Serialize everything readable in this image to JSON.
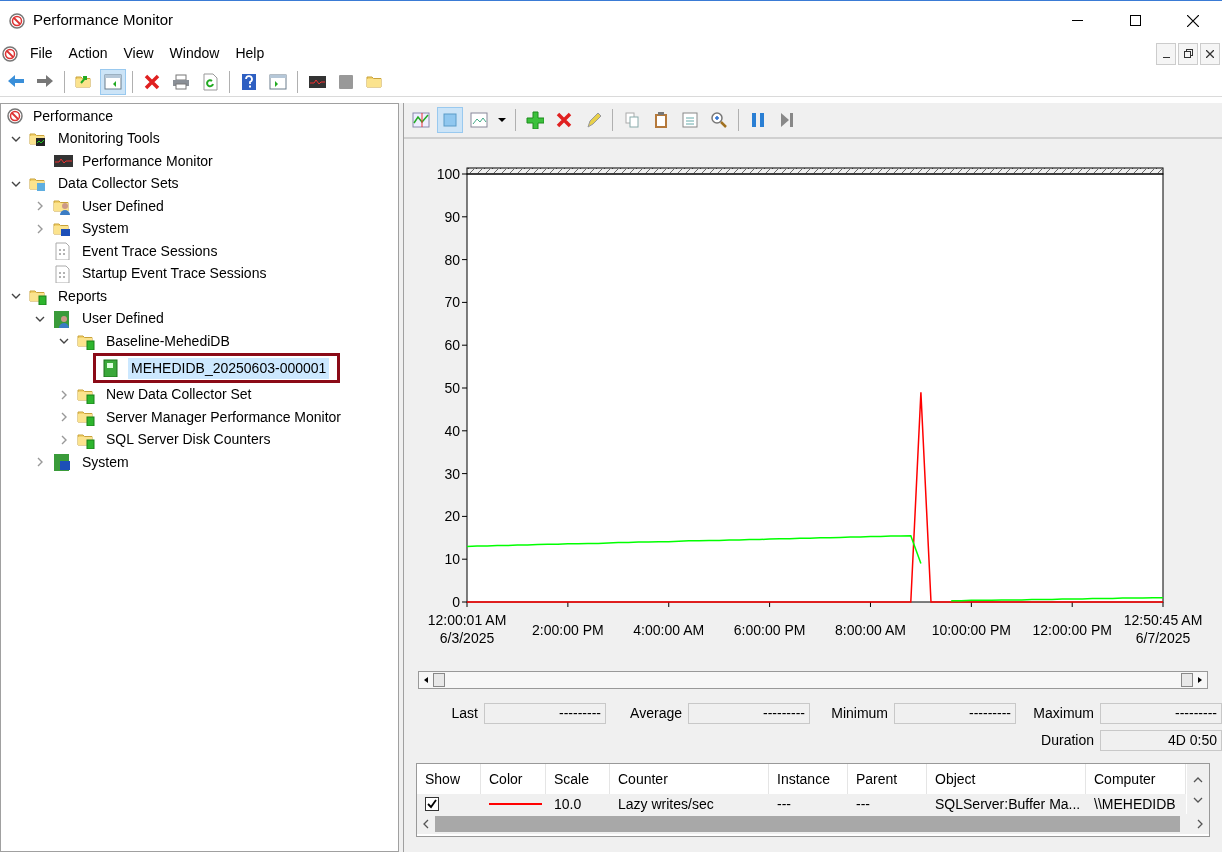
{
  "window": {
    "title": "Performance Monitor"
  },
  "menu": [
    "File",
    "Action",
    "View",
    "Window",
    "Help"
  ],
  "toolbar": [
    {
      "kind": "back",
      "selected": false
    },
    {
      "kind": "forward",
      "selected": false
    },
    {
      "kind": "sep"
    },
    {
      "kind": "up-folder",
      "selected": false
    },
    {
      "kind": "pane",
      "selected": true
    },
    {
      "kind": "sep"
    },
    {
      "kind": "delete",
      "selected": false
    },
    {
      "kind": "print",
      "selected": false
    },
    {
      "kind": "refresh",
      "selected": false
    },
    {
      "kind": "sep"
    },
    {
      "kind": "help",
      "selected": false
    },
    {
      "kind": "pane-right",
      "selected": false
    },
    {
      "kind": "sep"
    },
    {
      "kind": "monitor",
      "selected": false
    },
    {
      "kind": "stop",
      "selected": false
    },
    {
      "kind": "folder",
      "selected": false
    }
  ],
  "tree": {
    "label": "Performance",
    "children": [
      {
        "label": "Monitoring Tools",
        "kind": "folder-chart",
        "expanded": true,
        "children": [
          {
            "label": "Performance Monitor",
            "kind": "monitor"
          }
        ]
      },
      {
        "label": "Data Collector Sets",
        "kind": "folder-db",
        "expanded": true,
        "children": [
          {
            "label": "User Defined",
            "kind": "folder-user",
            "expanded": false
          },
          {
            "label": "System",
            "kind": "folder-system",
            "expanded": false
          },
          {
            "label": "Event Trace Sessions",
            "kind": "trace"
          },
          {
            "label": "Startup Event Trace Sessions",
            "kind": "trace"
          }
        ]
      },
      {
        "label": "Reports",
        "kind": "folder-report",
        "expanded": true,
        "children": [
          {
            "label": "User Defined",
            "kind": "report-user",
            "expanded": true,
            "children": [
              {
                "label": "Baseline-MehediDB",
                "kind": "folder-report",
                "expanded": true,
                "children": [
                  {
                    "label": "MEHEDIDB_20250603-000001",
                    "kind": "report",
                    "selected": true,
                    "highlighted": true
                  }
                ]
              },
              {
                "label": "New Data Collector Set",
                "kind": "folder-report",
                "expanded": false
              },
              {
                "label": "Server Manager Performance Monitor",
                "kind": "folder-report",
                "expanded": false
              },
              {
                "label": "SQL Server Disk Counters",
                "kind": "folder-report",
                "expanded": false
              }
            ]
          },
          {
            "label": "System",
            "kind": "report-system",
            "expanded": false
          }
        ]
      }
    ]
  },
  "chart_toolbar": [
    {
      "kind": "graph-type",
      "selected": false
    },
    {
      "kind": "clear",
      "selected": true
    },
    {
      "kind": "view-data",
      "selected": false
    },
    {
      "kind": "dropdown",
      "selected": false
    },
    {
      "kind": "sep"
    },
    {
      "kind": "add",
      "selected": false
    },
    {
      "kind": "delete",
      "selected": false
    },
    {
      "kind": "highlight",
      "selected": false
    },
    {
      "kind": "sep"
    },
    {
      "kind": "copy",
      "selected": false
    },
    {
      "kind": "paste",
      "selected": false
    },
    {
      "kind": "properties",
      "selected": false
    },
    {
      "kind": "zoom",
      "selected": false
    },
    {
      "kind": "sep"
    },
    {
      "kind": "pause",
      "selected": false
    },
    {
      "kind": "step",
      "selected": false
    }
  ],
  "chart_data": {
    "type": "line",
    "categories": [
      "12:00:01 AM\n6/3/2025",
      null,
      null,
      null,
      null,
      null,
      null,
      null,
      null,
      null,
      "2:00:00 PM",
      null,
      null,
      null,
      null,
      null,
      null,
      null,
      null,
      null,
      "4:00:00 AM",
      null,
      null,
      null,
      null,
      null,
      null,
      null,
      null,
      null,
      "6:00:00 PM",
      null,
      null,
      null,
      null,
      null,
      null,
      null,
      null,
      null,
      "8:00:00 AM",
      null,
      null,
      null,
      null,
      null,
      null,
      null,
      null,
      null,
      "10:00:00 PM",
      null,
      null,
      null,
      null,
      null,
      null,
      null,
      null,
      null,
      "12:00:00 PM",
      null,
      null,
      null,
      null,
      null,
      null,
      null,
      null,
      "12:50:45 AM\n6/7/2025"
    ],
    "series": [
      {
        "color": "#ff0000",
        "values": [
          0,
          0,
          0,
          0,
          0,
          0,
          0,
          0,
          0,
          0,
          0,
          0,
          0,
          0,
          0,
          0,
          0,
          0,
          0,
          0,
          0,
          0,
          0,
          0,
          0,
          0,
          0,
          0,
          0,
          0,
          0,
          0,
          0,
          0,
          0,
          0,
          0,
          0,
          0,
          0,
          0,
          0,
          0,
          0,
          0,
          49,
          0,
          0,
          0,
          0,
          0,
          0,
          0,
          0,
          0,
          0,
          0,
          0,
          0,
          0,
          0,
          0,
          0,
          0,
          0,
          0,
          0,
          0,
          0,
          0
        ]
      },
      {
        "color": "#00ff00",
        "values": [
          13,
          13.1,
          13.1,
          13.2,
          13.2,
          13.3,
          13.3,
          13.4,
          13.5,
          13.5,
          13.6,
          13.6,
          13.7,
          13.7,
          13.8,
          13.9,
          13.9,
          14,
          14,
          14.1,
          14.1,
          14.2,
          14.3,
          14.3,
          14.4,
          14.4,
          14.5,
          14.5,
          14.6,
          14.6,
          14.7,
          14.8,
          14.8,
          14.9,
          14.9,
          15,
          15,
          15.1,
          15.2,
          15.2,
          15.3,
          15.3,
          15.4,
          15.4,
          15.5,
          9,
          null,
          null,
          0.3,
          0.3,
          0.4,
          0.4,
          0.4,
          0.5,
          0.5,
          0.5,
          0.6,
          0.6,
          0.6,
          0.7,
          0.7,
          0.7,
          0.8,
          0.8,
          0.8,
          0.9,
          0.9,
          0.9,
          1,
          1
        ]
      }
    ],
    "ylim": [
      0,
      100
    ],
    "yticks": [
      0,
      10,
      20,
      30,
      40,
      50,
      60,
      70,
      80,
      90,
      100
    ]
  },
  "stats": [
    {
      "label": "Last",
      "value": "---------"
    },
    {
      "label": "Average",
      "value": "---------"
    },
    {
      "label": "Minimum",
      "value": "---------"
    },
    {
      "label": "Maximum",
      "value": "---------"
    },
    {
      "label": "Duration",
      "value": "4D 0:50"
    }
  ],
  "counters": {
    "columns": [
      "Show",
      "Color",
      "Scale",
      "Counter",
      "Instance",
      "Parent",
      "Object",
      "Computer"
    ],
    "rows": [
      {
        "show": true,
        "color": "#ff0000",
        "scale": "10.0",
        "counter": "Lazy writes/sec",
        "instance": "---",
        "parent": "---",
        "object": "SQLServer:Buffer Ma...",
        "computer": "\\\\MEHEDIDB"
      }
    ]
  }
}
